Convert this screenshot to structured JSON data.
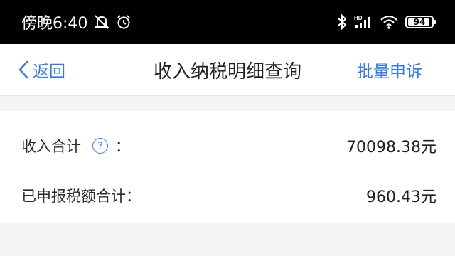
{
  "status_bar": {
    "time": "傍晚6:40",
    "battery": "94",
    "battery_level_percent": 94,
    "left_icons": [
      "mute-icon",
      "alarm-icon"
    ],
    "right_icons": [
      "bluetooth-icon",
      "signal-icon",
      "wifi-icon",
      "battery-icon"
    ],
    "hd_label": "HD"
  },
  "nav": {
    "back_label": "返回",
    "title": "收入纳税明细查询",
    "right_action": "批量申诉"
  },
  "summary": {
    "income_total_label": "收入合计",
    "income_total_colon": "：",
    "income_total_value": "70098.38元",
    "tax_total_label": "已申报税额合计：",
    "tax_total_value": "960.43元"
  },
  "colors": {
    "accent": "#3a7bd5",
    "status_bar_bg": "#000000",
    "page_bg": "#f4f5f7"
  }
}
